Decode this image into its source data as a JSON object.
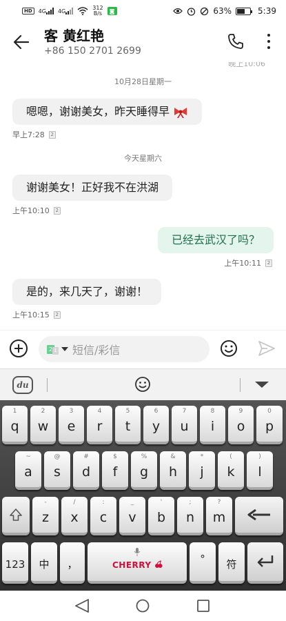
{
  "status_bar": {
    "hd": "HD",
    "network_1": "4G",
    "network_2": "4G",
    "speed_value": "312",
    "speed_unit": "B/s",
    "battery_percent": "63%",
    "battery_level": 0.63,
    "time": "5:39"
  },
  "header": {
    "contact_name": "客 黄红艳",
    "contact_phone": "+86 150 2701 2699"
  },
  "messages": {
    "clipped_time": "晚上10:06",
    "items": [
      {
        "type": "date",
        "text": "10月28日星期一"
      },
      {
        "type": "in",
        "text": "嗯嗯，谢谢美女，昨天睡得早",
        "time": "早上7:28",
        "sim": "2"
      },
      {
        "type": "date",
        "text": "今天星期六"
      },
      {
        "type": "in",
        "text": "谢谢美女！正好我不在洪湖",
        "time": "上午10:10",
        "sim": "2"
      },
      {
        "type": "out",
        "text": "已经去武汉了吗？",
        "time": "上午10:11",
        "sim": "2"
      },
      {
        "type": "in",
        "text": "是的，来几天了，谢谢！",
        "time": "上午10:15",
        "sim": "2"
      }
    ]
  },
  "composer": {
    "placeholder": "短信/彩信",
    "sim_primary": "2",
    "sim_secondary": "1"
  },
  "ime": {
    "logo": "du"
  },
  "keyboard": {
    "row1": [
      [
        "q",
        "1"
      ],
      [
        "w",
        "2"
      ],
      [
        "e",
        "3"
      ],
      [
        "r",
        "4"
      ],
      [
        "t",
        "5"
      ],
      [
        "y",
        "6"
      ],
      [
        "u",
        "7"
      ],
      [
        "i",
        "8"
      ],
      [
        "o",
        "9"
      ],
      [
        "p",
        "0"
      ]
    ],
    "row2": [
      [
        "a",
        "~"
      ],
      [
        "s",
        "@"
      ],
      [
        "d",
        "#"
      ],
      [
        "f",
        "$"
      ],
      [
        "g",
        "%"
      ],
      [
        "h",
        "&"
      ],
      [
        "j",
        "*"
      ],
      [
        "k",
        "("
      ],
      [
        "l",
        ")"
      ]
    ],
    "row3": [
      [
        "z",
        "-"
      ],
      [
        "x",
        "/"
      ],
      [
        "c",
        ":"
      ],
      [
        "v",
        "_"
      ],
      [
        "b",
        "'"
      ],
      [
        "n",
        ";"
      ],
      [
        "m",
        "?"
      ]
    ],
    "num_label": "123",
    "zh_label": "中",
    "comma_label": "，",
    "space_brand": "CHERRY",
    "degree_label": "°",
    "symbol_label": "符"
  },
  "colors": {
    "out_bubble": "#e3f5ec",
    "out_text": "#1f6f4a",
    "in_bubble": "#f1f1f1",
    "brand_red": "#d0103a"
  }
}
